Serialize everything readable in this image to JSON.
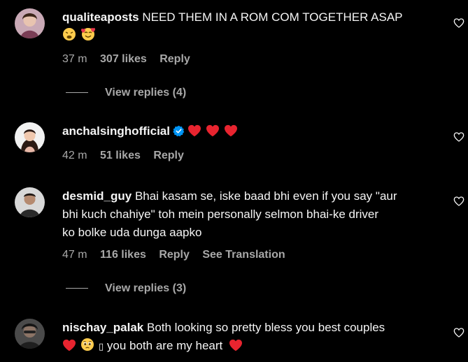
{
  "comments": [
    {
      "username": "qualiteaposts",
      "text": "NEED THEM IN A ROM COM TOGETHER ASAP",
      "emoji": [
        "weary-face",
        "smiling-face-with-hearts"
      ],
      "time": "37 m",
      "likes": "307 likes",
      "reply": "Reply",
      "view_replies": "View replies (4)"
    },
    {
      "username": "anchalsinghofficial",
      "verified": true,
      "emoji": [
        "red-heart",
        "red-heart",
        "red-heart"
      ],
      "time": "42 m",
      "likes": "51 likes",
      "reply": "Reply"
    },
    {
      "username": "desmid_guy",
      "line1": "Bhai kasam se, iske baad bhi even if you say \"aur",
      "line2": "bhi kuch chahiye\" toh mein personally selmon bhai-ke driver",
      "line3": "ko bolke uda dunga aapko",
      "time": "47 m",
      "likes": "116 likes",
      "reply": "Reply",
      "translate": "See Translation",
      "view_replies": "View replies (3)"
    },
    {
      "username": "nischay_palak",
      "line1": "Both looking so pretty bless you best couples",
      "missing_glyph": "▯",
      "line2": "you both are my heart",
      "emoji": [
        "red-heart",
        "pleading-face",
        "red-heart"
      ]
    }
  ],
  "colors": {
    "background": "#000000",
    "text": "#f5f5f5",
    "muted": "#a8a8a8",
    "heart": "#ff3040",
    "verified": "#0095f6"
  }
}
